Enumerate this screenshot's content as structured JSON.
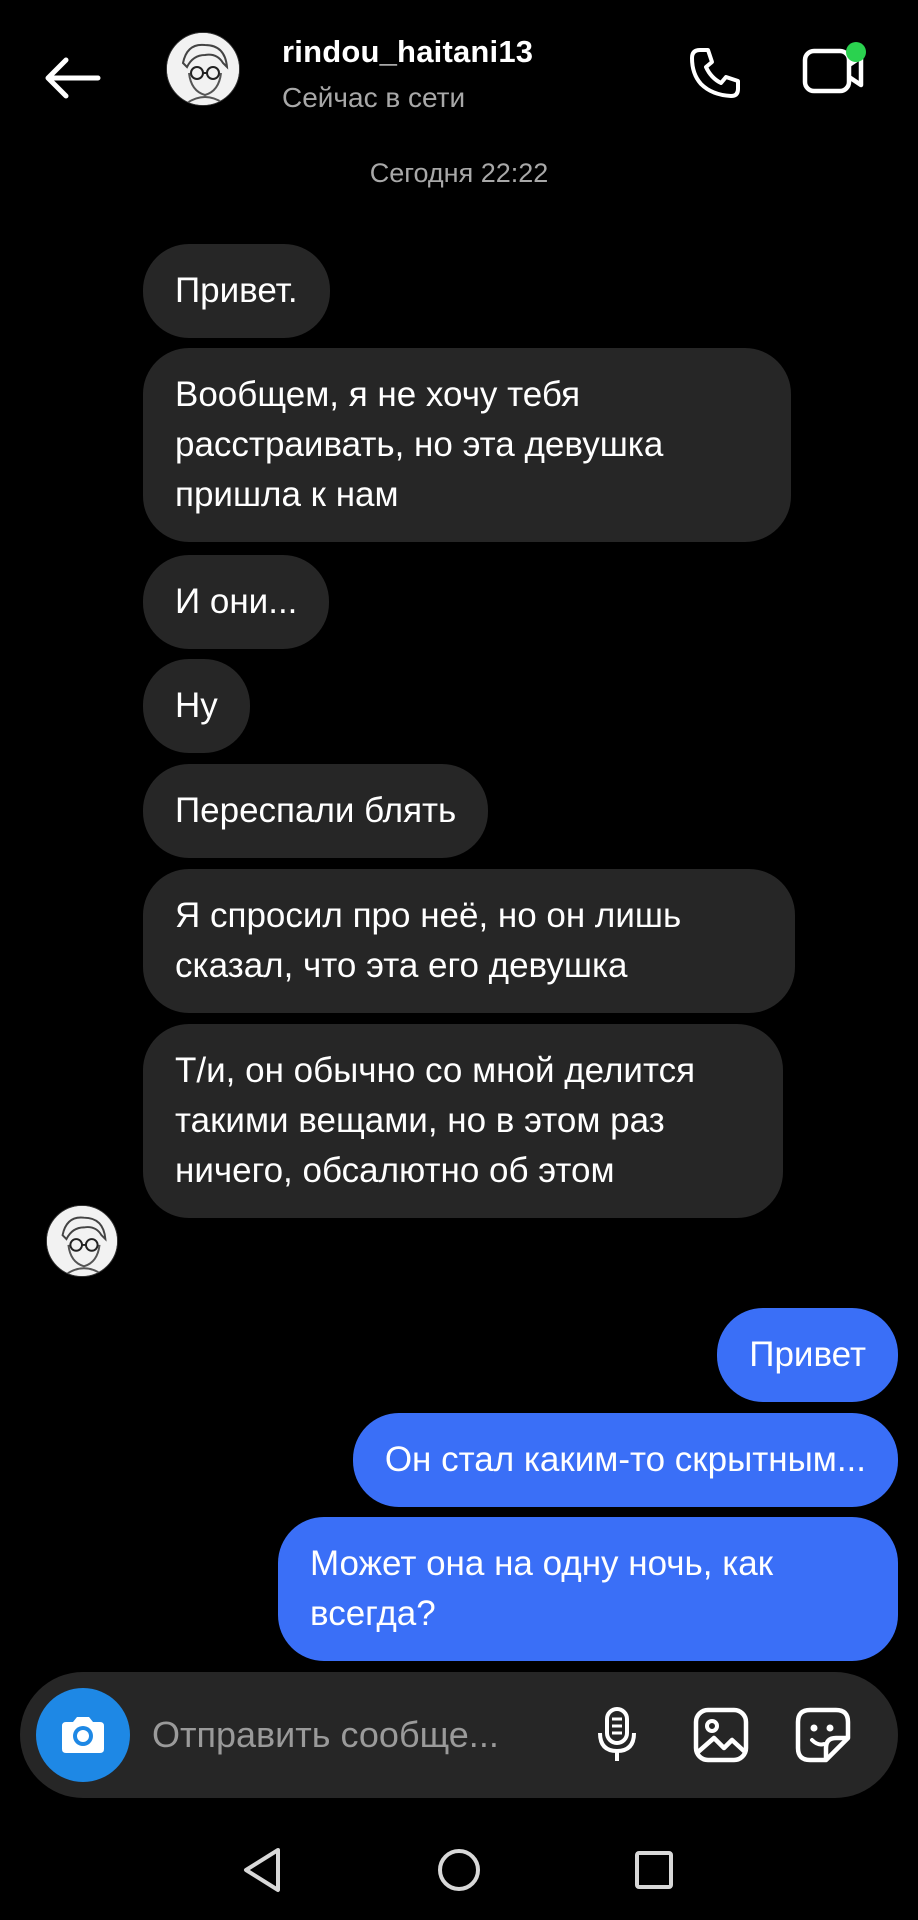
{
  "header": {
    "username": "rindou_haitani13",
    "status": "Сейчас в сети",
    "icons": {
      "back": "arrow-left-icon",
      "call": "phone-icon",
      "video": "video-camera-icon"
    },
    "online_color": "#2ad24f"
  },
  "chat": {
    "timestamp": "Сегодня 22:22",
    "incoming": [
      {
        "text": "Привет."
      },
      {
        "text": "Вообщем, я не хочу тебя расстраивать, но эта девушка пришла к нам"
      },
      {
        "text": "И они..."
      },
      {
        "text": "Ну"
      },
      {
        "text": "Переспали блять"
      },
      {
        "text": "Я спросил про неё, но он лишь сказал, что эта его девушка"
      },
      {
        "text": "Т/и, он обычно со мной делится такими вещами, но в этом раз ничего, обсалютно об этом"
      }
    ],
    "outgoing": [
      {
        "text": "Привет"
      },
      {
        "text": "Он стал каким-то скрытным..."
      },
      {
        "text": "Может она на одну ночь, как всегда?"
      }
    ],
    "colors": {
      "incoming_bubble": "#262626",
      "outgoing_bubble": "#3a6ff7"
    }
  },
  "composer": {
    "placeholder": "Отправить сообще...",
    "icons": {
      "camera": "camera-icon",
      "mic": "microphone-icon",
      "gallery": "image-icon",
      "sticker": "sticker-icon"
    },
    "camera_color": "#1e88e5"
  },
  "navbar": {
    "icons": {
      "back": "nav-back-icon",
      "home": "nav-home-icon",
      "recents": "nav-recents-icon"
    }
  }
}
